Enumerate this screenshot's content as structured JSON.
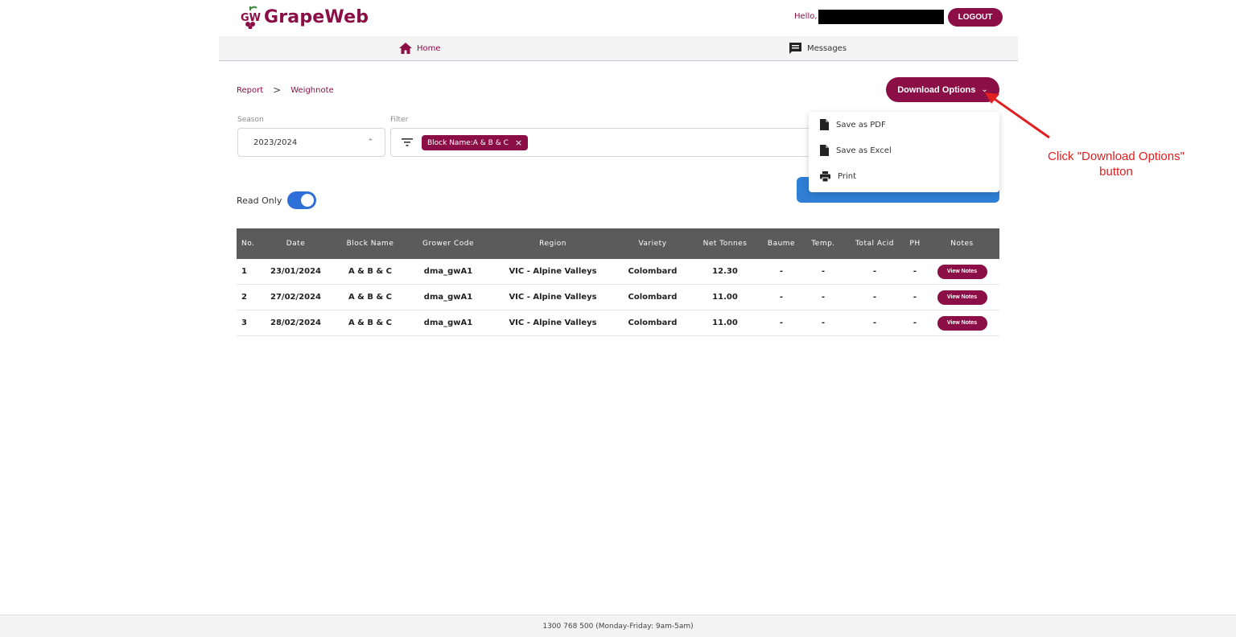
{
  "header": {
    "brand": "GrapeWeb",
    "hello": "Hello,",
    "logout_label": "LOGOUT"
  },
  "nav": {
    "home_label": "Home",
    "messages_label": "Messages"
  },
  "breadcrumb": {
    "items": [
      "Report",
      "Weighnote"
    ],
    "separator": ">"
  },
  "download": {
    "label": "Download Options",
    "menu": [
      "Save as PDF",
      "Save as Excel",
      "Print"
    ]
  },
  "filters": {
    "season_label": "Season",
    "season_value": "2023/2024",
    "filter_label": "Filter",
    "chip": "Block Name:A & B & C"
  },
  "toggle": {
    "label": "Read Only",
    "on": true
  },
  "annotation": {
    "text": "Click \"Download Options\" button",
    "color": "#e02020"
  },
  "table": {
    "columns": [
      "No.",
      "Date",
      "Block Name",
      "Grower Code",
      "Region",
      "Variety",
      "Net Tonnes",
      "Baume",
      "Temp.",
      "Total Acid",
      "PH",
      "Notes"
    ],
    "rows": [
      [
        "1",
        "23/01/2024",
        "A & B & C",
        "dma_gwA1",
        "VIC - Alpine Valleys",
        "Colombard",
        "12.30",
        "-",
        "-",
        "-",
        "-",
        "View Notes"
      ],
      [
        "2",
        "27/02/2024",
        "A & B & C",
        "dma_gwA1",
        "VIC - Alpine Valleys",
        "Colombard",
        "11.00",
        "-",
        "-",
        "-",
        "-",
        "View Notes"
      ],
      [
        "3",
        "28/02/2024",
        "A & B & C",
        "dma_gwA1",
        "VIC - Alpine Valleys",
        "Colombard",
        "11.00",
        "-",
        "-",
        "-",
        "-",
        "View Notes"
      ]
    ]
  },
  "footer": {
    "text": "1300 768 500 (Monday-Friday: 9am-5am)"
  },
  "colors": {
    "brand": "#8b0e46",
    "accent_blue": "#2f7fd6",
    "table_header": "#5b5b5b"
  }
}
